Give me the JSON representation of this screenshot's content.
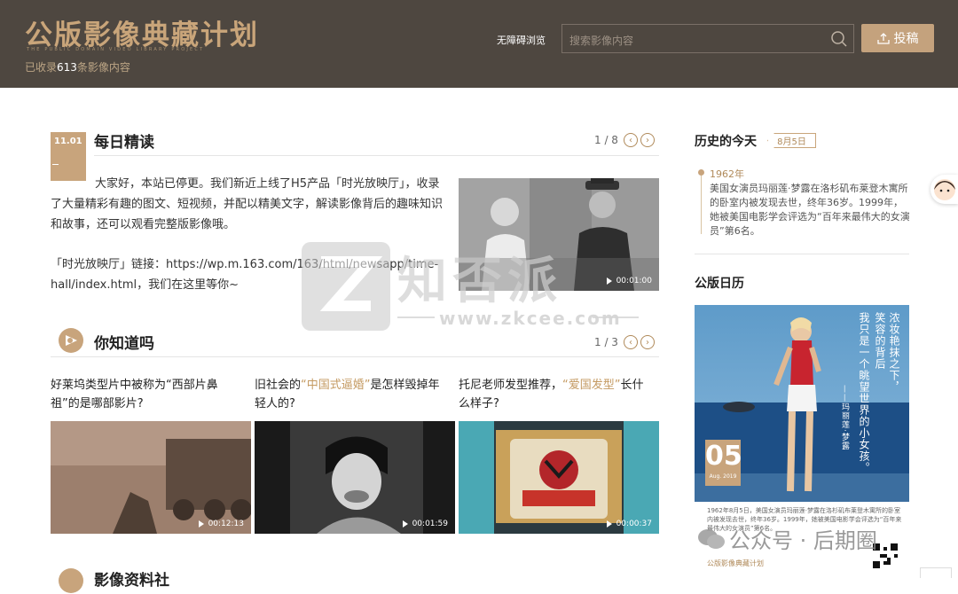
{
  "header": {
    "logo": "公版影像典藏计划",
    "logo_sub": "THE PUBLIC DOMAIN VIDEO LIBRARY PROJECT",
    "count_prefix": "已收录",
    "count_num": "613",
    "count_suffix": "条影像内容",
    "accessibility": "无障碍浏览",
    "search_placeholder": "搜索影像内容",
    "upload_label": "投稿"
  },
  "daily": {
    "title": "每日精读",
    "badge": "11.01",
    "pager": "1 / 8",
    "para1": "大家好，本站已停更。我们新近上线了H5产品「时光放映厅」，收录了大量精彩有趣的图文、短视频，并配以精美文字，解读影像背后的趣味知识和故事，还可以观看完整版影像哦。",
    "para2": "「时光放映厅」链接：https://wp.m.163.com/163/html/newsapp/time-hall/index.html，我们在这里等你~",
    "video_duration": "00:01:00"
  },
  "dyk": {
    "title": "你知道吗",
    "pager": "1 / 3",
    "items": [
      {
        "pre": "好莱坞类型片中被称为“西部片鼻祖”的是哪部影片?",
        "hl": "",
        "post": "",
        "duration": "00:12:13"
      },
      {
        "pre": "旧社会的",
        "hl": "“中国式逼婚”",
        "post": "是怎样毁掉年轻人的?",
        "duration": "00:01:59"
      },
      {
        "pre": "托尼老师发型推荐，",
        "hl": "“爱国发型”",
        "post": "长什么样子?",
        "duration": "00:00:37"
      }
    ]
  },
  "history": {
    "title": "历史的今天",
    "date": "8月5日",
    "year": "1962年",
    "text": "美国女演员玛丽莲·梦露在洛杉矶布莱登木寓所的卧室内被发现去世，终年36岁。1999年，她被美国电影学会评选为“百年来最伟大的女演员”第6名。"
  },
  "calendar": {
    "title": "公版日历",
    "day": "05",
    "month": "Aug. 2019",
    "vert_lines": [
      "浓妆艳抹之下，",
      "笑容的背后",
      "我只是一个眺望世界的小女孩。",
      "——玛丽莲·梦露"
    ],
    "caption": "1962年8月5日，美国女演员玛丽莲·梦露在洛杉矶布莱登木寓所的卧室内被发现去世，终年36岁。1999年，她被美国电影学会评选为“百年来最伟大的女演员”第6名。",
    "brand": "公版影像典藏计划"
  },
  "watermark": {
    "zk_text": "知否派",
    "zk_url": "www.zkcee.com",
    "wechat": "公众号 · 后期圈"
  },
  "bottom": {
    "title": "影像资料社"
  }
}
